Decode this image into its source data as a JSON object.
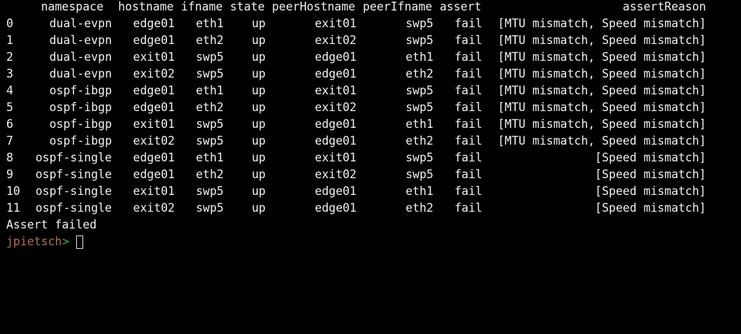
{
  "terminal": {
    "columns": [
      "namespace",
      "hostname",
      "ifname",
      "state",
      "peerHostname",
      "peerIfname",
      "assert",
      "assertReason"
    ],
    "rows": [
      {
        "idx": "0",
        "namespace": "dual-evpn",
        "hostname": "edge01",
        "ifname": "eth1",
        "state": "up",
        "peerHostname": "exit01",
        "peerIfname": "swp5",
        "assert": "fail",
        "assertReason": "[MTU mismatch, Speed mismatch]"
      },
      {
        "idx": "1",
        "namespace": "dual-evpn",
        "hostname": "edge01",
        "ifname": "eth2",
        "state": "up",
        "peerHostname": "exit02",
        "peerIfname": "swp5",
        "assert": "fail",
        "assertReason": "[MTU mismatch, Speed mismatch]"
      },
      {
        "idx": "2",
        "namespace": "dual-evpn",
        "hostname": "exit01",
        "ifname": "swp5",
        "state": "up",
        "peerHostname": "edge01",
        "peerIfname": "eth1",
        "assert": "fail",
        "assertReason": "[MTU mismatch, Speed mismatch]"
      },
      {
        "idx": "3",
        "namespace": "dual-evpn",
        "hostname": "exit02",
        "ifname": "swp5",
        "state": "up",
        "peerHostname": "edge01",
        "peerIfname": "eth2",
        "assert": "fail",
        "assertReason": "[MTU mismatch, Speed mismatch]"
      },
      {
        "idx": "4",
        "namespace": "ospf-ibgp",
        "hostname": "edge01",
        "ifname": "eth1",
        "state": "up",
        "peerHostname": "exit01",
        "peerIfname": "swp5",
        "assert": "fail",
        "assertReason": "[MTU mismatch, Speed mismatch]"
      },
      {
        "idx": "5",
        "namespace": "ospf-ibgp",
        "hostname": "edge01",
        "ifname": "eth2",
        "state": "up",
        "peerHostname": "exit02",
        "peerIfname": "swp5",
        "assert": "fail",
        "assertReason": "[MTU mismatch, Speed mismatch]"
      },
      {
        "idx": "6",
        "namespace": "ospf-ibgp",
        "hostname": "exit01",
        "ifname": "swp5",
        "state": "up",
        "peerHostname": "edge01",
        "peerIfname": "eth1",
        "assert": "fail",
        "assertReason": "[MTU mismatch, Speed mismatch]"
      },
      {
        "idx": "7",
        "namespace": "ospf-ibgp",
        "hostname": "exit02",
        "ifname": "swp5",
        "state": "up",
        "peerHostname": "edge01",
        "peerIfname": "eth2",
        "assert": "fail",
        "assertReason": "[MTU mismatch, Speed mismatch]"
      },
      {
        "idx": "8",
        "namespace": "ospf-single",
        "hostname": "edge01",
        "ifname": "eth1",
        "state": "up",
        "peerHostname": "exit01",
        "peerIfname": "swp5",
        "assert": "fail",
        "assertReason": "[Speed mismatch]"
      },
      {
        "idx": "9",
        "namespace": "ospf-single",
        "hostname": "edge01",
        "ifname": "eth2",
        "state": "up",
        "peerHostname": "exit02",
        "peerIfname": "swp5",
        "assert": "fail",
        "assertReason": "[Speed mismatch]"
      },
      {
        "idx": "10",
        "namespace": "ospf-single",
        "hostname": "exit01",
        "ifname": "swp5",
        "state": "up",
        "peerHostname": "edge01",
        "peerIfname": "eth1",
        "assert": "fail",
        "assertReason": "[Speed mismatch]"
      },
      {
        "idx": "11",
        "namespace": "ospf-single",
        "hostname": "exit02",
        "ifname": "swp5",
        "state": "up",
        "peerHostname": "edge01",
        "peerIfname": "eth2",
        "assert": "fail",
        "assertReason": "[Speed mismatch]"
      }
    ],
    "message": "Assert failed",
    "prompt": {
      "user": "jpietsch",
      "caret": ">",
      "input": ""
    },
    "colors": {
      "background": "#000000",
      "text": "#f2f2f2",
      "prompt_user": "#a9715a",
      "prompt_caret": "#36b35d"
    }
  }
}
